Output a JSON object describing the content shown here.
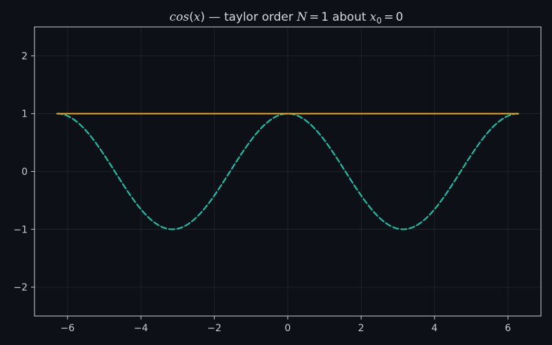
{
  "chart_data": {
    "type": "line",
    "title": {
      "func": "cos",
      "var": "x",
      "dash": "—",
      "text_mid": "taylor order",
      "N_symbol": "N",
      "eq": "=",
      "N_value": "1",
      "about": "about",
      "x0_base": "x",
      "x0_sub": "0",
      "x0_value": "0"
    },
    "xlabel": "",
    "ylabel": "",
    "xlim": [
      -6.9,
      6.9
    ],
    "ylim": [
      -2.5,
      2.5
    ],
    "x_ticks": [
      -6,
      -4,
      -2,
      0,
      2,
      4,
      6
    ],
    "y_ticks": [
      -2,
      -1,
      0,
      1,
      2
    ],
    "x_tick_labels": [
      "−6",
      "−4",
      "−2",
      "0",
      "2",
      "4",
      "6"
    ],
    "y_tick_labels": [
      "−2",
      "−1",
      "0",
      "1",
      "2"
    ],
    "grid": true,
    "series": [
      {
        "function": "cos",
        "domain": [
          -6.2832,
          6.2832
        ],
        "style": "dashed",
        "color": "#1fbfa6"
      },
      {
        "function": "taylor_cos_order_1",
        "domain": [
          -6.2832,
          6.2832
        ],
        "value": 1,
        "style": "solid",
        "color": "#e5a21e"
      }
    ]
  },
  "colors": {
    "background": "#0d1017",
    "frame": "#cfd3d8",
    "text": "#c9cdd3"
  }
}
